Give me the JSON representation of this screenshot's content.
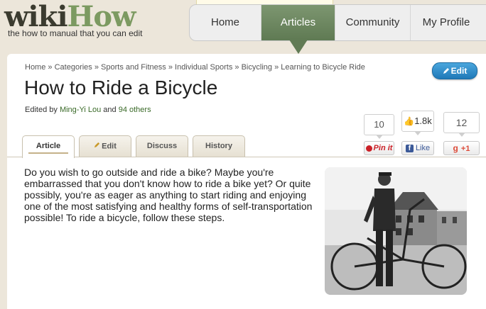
{
  "logo": {
    "wiki": "wiki",
    "how": "How"
  },
  "tagline": "the how to manual that you can edit",
  "nav": {
    "home": "Home",
    "articles": "Articles",
    "community": "Community",
    "profile": "My Profile"
  },
  "breadcrumb": [
    "Home",
    "Categories",
    "Sports and Fitness",
    "Individual Sports",
    "Bicycling",
    "Learning to Bicycle Ride"
  ],
  "breadcrumb_sep": "»",
  "edit_button": "Edit",
  "title": "How to Ride a Bicycle",
  "edited": {
    "prefix": "Edited by",
    "author": "Ming-Yi Lou",
    "and": "and",
    "others": "94 others"
  },
  "social": {
    "pinit_count": "10",
    "pinit_label": "Pin it",
    "fb_count": "1.8k",
    "fb_label": "Like",
    "gplus_count": "12",
    "gplus_label": "+1"
  },
  "tabs": {
    "article": "Article",
    "edit": "Edit",
    "discuss": "Discuss",
    "history": "History"
  },
  "intro": "Do you wish to go outside and ride a bike? Maybe you're embarrassed that you don't know how to ride a bike yet? Or quite possibly, you're as eager as anything to start riding and enjoying one of the most satisfying and healthy forms of self-transportation possible! To ride a bicycle, follow these steps.",
  "colors": {
    "brand_green": "#7c9a61",
    "nav_active": "#617b55",
    "edit_blue": "#2b88c8",
    "pinterest_red": "#cb2027",
    "facebook_blue": "#3b5998",
    "gplus_red": "#dd4b39"
  }
}
